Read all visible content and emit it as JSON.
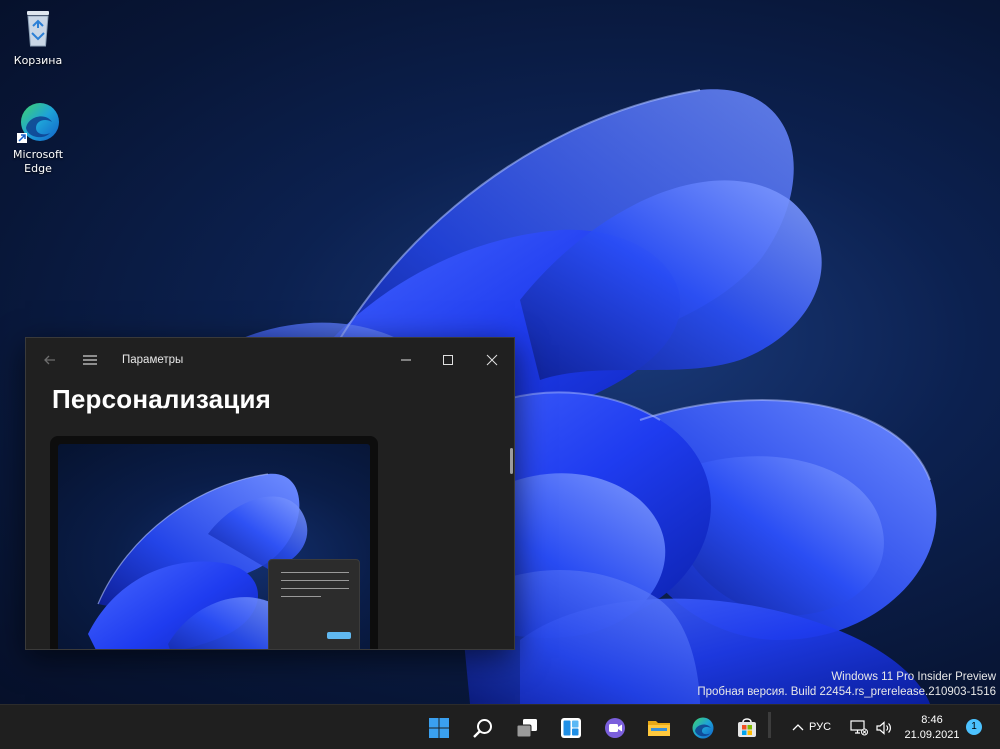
{
  "desktop": {
    "icons": [
      {
        "label": "Корзина",
        "icon": "recycle-bin-icon"
      },
      {
        "label": "Microsoft\nEdge",
        "icon": "edge-icon"
      }
    ],
    "watermark": {
      "line1": "Windows 11 Pro Insider Preview",
      "line2": "Пробная версия. Build 22454.rs_prerelease.210903-1516"
    }
  },
  "window": {
    "title": "Параметры",
    "heading": "Персонализация",
    "controls": [
      "minimize-icon",
      "maximize-icon",
      "close-icon"
    ]
  },
  "taskbar": {
    "apps": [
      "start-icon",
      "search-icon",
      "task-view-icon",
      "widgets-icon",
      "chat-icon",
      "file-explorer-icon",
      "edge-icon",
      "store-icon"
    ],
    "language": "РУС",
    "time": "8:46",
    "date": "21.09.2021",
    "notifications": "1"
  },
  "colors": {
    "accent": "#4cc2ff",
    "window_bg": "#202020",
    "taskbar_bg": "#1f1f1f",
    "wallpaper_blue": "#1a3cff"
  }
}
